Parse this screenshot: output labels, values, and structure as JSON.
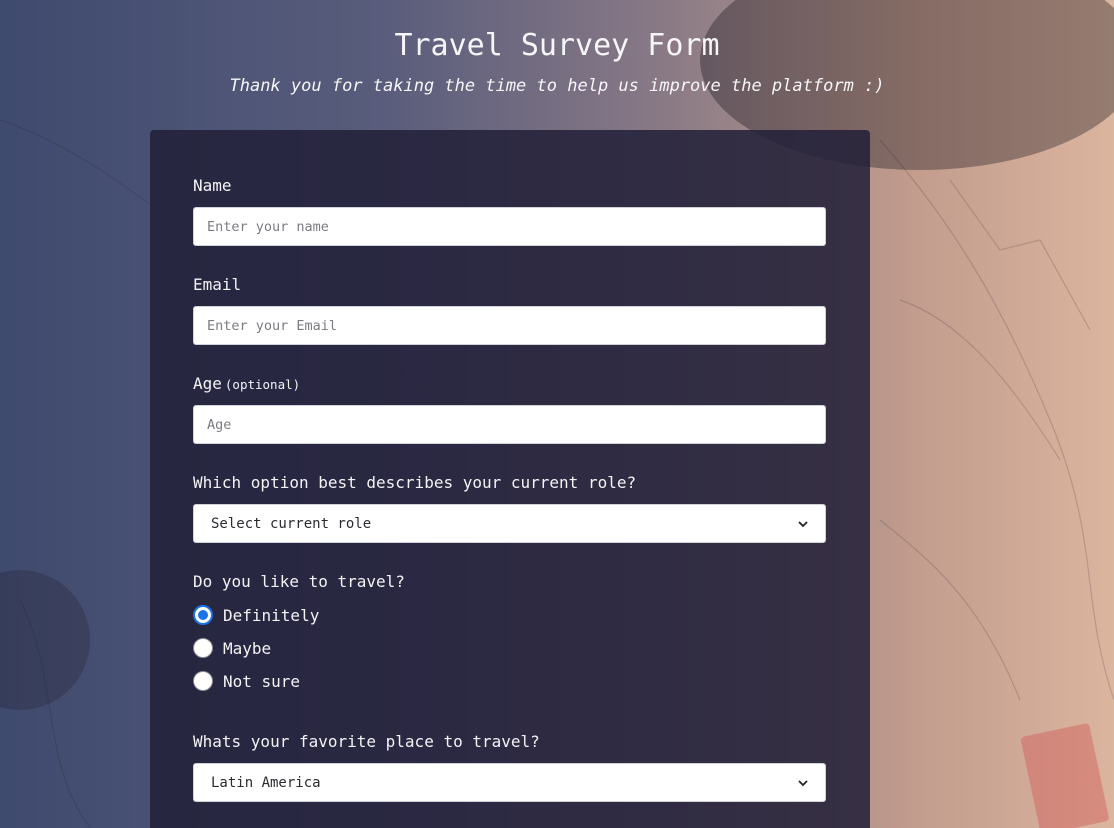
{
  "header": {
    "title": "Travel Survey Form",
    "subtitle": "Thank you for taking the time to help us improve the platform :)"
  },
  "form": {
    "name": {
      "label": "Name",
      "placeholder": "Enter your name",
      "value": ""
    },
    "email": {
      "label": "Email",
      "placeholder": "Enter your Email",
      "value": ""
    },
    "age": {
      "label": "Age",
      "optional_note": "(optional)",
      "placeholder": "Age",
      "value": ""
    },
    "role": {
      "label": "Which option best describes your current role?",
      "selected": "Select current role"
    },
    "travel": {
      "label": "Do you like to travel?",
      "options": [
        {
          "label": "Definitely",
          "checked": true
        },
        {
          "label": "Maybe",
          "checked": false
        },
        {
          "label": "Not sure",
          "checked": false
        }
      ]
    },
    "favorite_place": {
      "label": "Whats your favorite place to travel?",
      "selected": "Latin America"
    }
  },
  "icons": {
    "select_arrow": "chevron-down-icon",
    "radio_selected_color": "#1a73e8"
  }
}
